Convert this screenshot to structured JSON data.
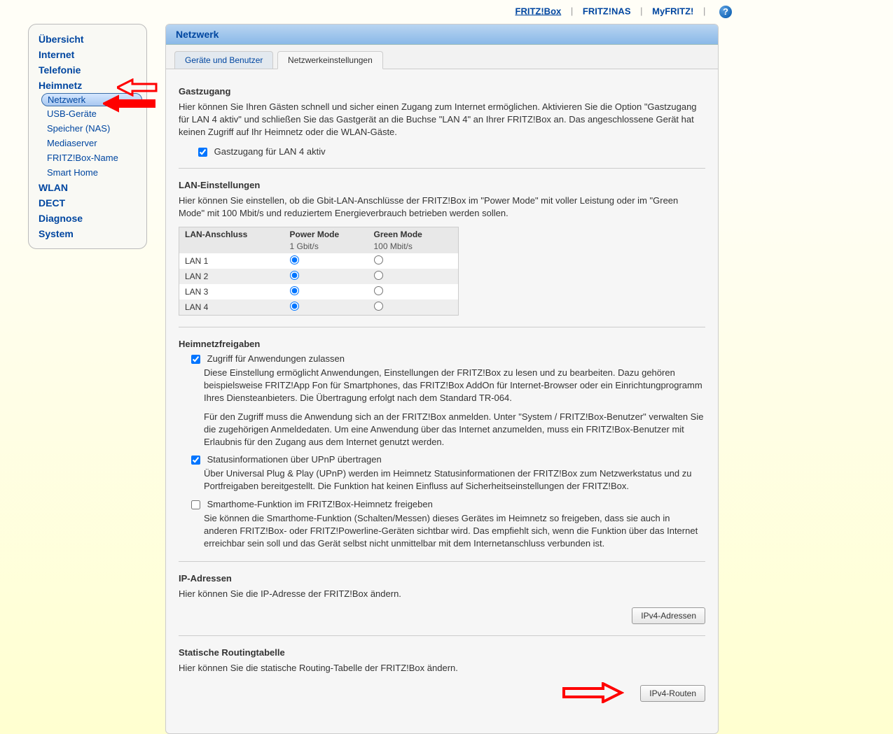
{
  "topnav": {
    "items": [
      {
        "label": "FRITZ!Box",
        "active": true
      },
      {
        "label": "FRITZ!NAS",
        "active": false
      },
      {
        "label": "MyFRITZ!",
        "active": false
      }
    ],
    "help": "?"
  },
  "sidebar": {
    "items": [
      {
        "label": "Übersicht",
        "type": "main"
      },
      {
        "label": "Internet",
        "type": "main"
      },
      {
        "label": "Telefonie",
        "type": "main"
      },
      {
        "label": "Heimnetz",
        "type": "main"
      },
      {
        "label": "Netzwerk",
        "type": "sub",
        "selected": true
      },
      {
        "label": "USB-Geräte",
        "type": "sub"
      },
      {
        "label": "Speicher (NAS)",
        "type": "sub"
      },
      {
        "label": "Mediaserver",
        "type": "sub"
      },
      {
        "label": "FRITZ!Box-Name",
        "type": "sub"
      },
      {
        "label": "Smart Home",
        "type": "sub"
      },
      {
        "label": "WLAN",
        "type": "main"
      },
      {
        "label": "DECT",
        "type": "main"
      },
      {
        "label": "Diagnose",
        "type": "main"
      },
      {
        "label": "System",
        "type": "main"
      }
    ]
  },
  "panel": {
    "title": "Netzwerk",
    "tabs": [
      {
        "label": "Geräte und Benutzer",
        "active": false
      },
      {
        "label": "Netzwerkeinstellungen",
        "active": true
      }
    ]
  },
  "gast": {
    "title": "Gastzugang",
    "desc": "Hier können Sie Ihren Gästen schnell und sicher einen Zugang zum Internet ermöglichen. Aktivieren Sie die Option \"Gastzugang für LAN 4 aktiv\" und schließen Sie das Gastgerät an die Buchse \"LAN 4\" an Ihrer FRITZ!Box an. Das angeschlossene Gerät hat keinen Zugriff auf Ihr Heimnetz oder die WLAN-Gäste.",
    "checkbox_label": "Gastzugang für LAN 4 aktiv"
  },
  "lan": {
    "title": "LAN-Einstellungen",
    "desc": "Hier können Sie einstellen, ob die Gbit-LAN-Anschlüsse der FRITZ!Box im \"Power Mode\" mit voller Leistung oder im \"Green Mode\" mit 100 Mbit/s und reduziertem Energieverbrauch betrieben werden sollen.",
    "col1": "LAN-Anschluss",
    "col2": "Power Mode",
    "col2_sub": "1 Gbit/s",
    "col3": "Green Mode",
    "col3_sub": "100 Mbit/s",
    "rows": [
      "LAN 1",
      "LAN 2",
      "LAN 3",
      "LAN 4"
    ]
  },
  "heimnetz": {
    "title": "Heimnetzfreigaben",
    "opt1_label": "Zugriff für Anwendungen zulassen",
    "opt1_desc1": "Diese Einstellung ermöglicht Anwendungen, Einstellungen der FRITZ!Box zu lesen und zu bearbeiten. Dazu gehören beispielsweise FRITZ!App Fon für Smartphones, das FRITZ!Box AddOn für Internet-Browser oder ein Einrichtungprogramm Ihres Diensteanbieters. Die Übertragung erfolgt nach dem Standard TR-064.",
    "opt1_desc2": "Für den Zugriff muss die Anwendung sich an der FRITZ!Box anmelden. Unter \"System / FRITZ!Box-Benutzer\" verwalten Sie die zugehörigen Anmeldedaten. Um eine Anwendung über das Internet anzumelden, muss ein FRITZ!Box-Benutzer mit Erlaubnis für den Zugang aus dem Internet genutzt werden.",
    "opt2_label": "Statusinformationen über UPnP übertragen",
    "opt2_desc": "Über Universal Plug & Play (UPnP) werden im Heimnetz Statusinformationen der FRITZ!Box zum Netzwerkstatus und zu Portfreigaben bereitgestellt. Die Funktion hat keinen Einfluss auf Sicherheitseinstellungen der FRITZ!Box.",
    "opt3_label": "Smarthome-Funktion im FRITZ!Box-Heimnetz freigeben",
    "opt3_desc": "Sie können die Smarthome-Funktion (Schalten/Messen) dieses Gerätes im Heimnetz so freigeben, dass sie auch in anderen FRITZ!Box- oder FRITZ!Powerline-Geräten sichtbar wird. Das empfiehlt sich, wenn die Funktion über das Internet erreichbar sein soll und das Gerät selbst nicht unmittelbar mit dem Internetanschluss verbunden ist."
  },
  "ip": {
    "title": "IP-Adressen",
    "desc": "Hier können Sie die IP-Adresse der FRITZ!Box ändern.",
    "button": "IPv4-Adressen"
  },
  "routing": {
    "title": "Statische Routingtabelle",
    "desc": "Hier können Sie die statische Routing-Tabelle der FRITZ!Box ändern.",
    "button": "IPv4-Routen"
  }
}
